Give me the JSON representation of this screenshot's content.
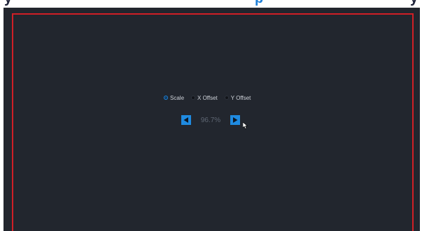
{
  "header": {
    "cut_text_dark_1": "y",
    "cut_text_accent": "p",
    "cut_text_dark_2": "y"
  },
  "adjust": {
    "modes": [
      {
        "label": "Scale",
        "selected": true
      },
      {
        "label": "X Offset",
        "selected": false
      },
      {
        "label": "Y Offset",
        "selected": false
      }
    ],
    "value": "96.7%",
    "decrease_icon": "triangle-left-icon",
    "increase_icon": "triangle-right-icon"
  },
  "colors": {
    "background": "#22262e",
    "frame_border": "#d11f26",
    "accent": "#1f8ae0",
    "label_text": "#cfd3da",
    "value_text": "#5e6673"
  }
}
